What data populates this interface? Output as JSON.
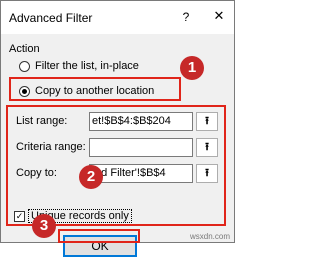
{
  "dialog": {
    "title": "Advanced Filter",
    "help_glyph": "?",
    "close_glyph": "✕"
  },
  "action": {
    "label": "Action",
    "options": [
      {
        "label": "Filter the list, in-place",
        "selected": false
      },
      {
        "label": "Copy to another location",
        "selected": true
      }
    ]
  },
  "fields": {
    "list_range": {
      "label": "List range:",
      "value": "et!$B$4:$B$204"
    },
    "criteria_range": {
      "label": "Criteria range:",
      "value": ""
    },
    "copy_to": {
      "label": "Copy to:",
      "value": ":ed Filter'!$B$4"
    },
    "collapse_glyph": "⭱"
  },
  "unique_records": {
    "label": "Unique records only",
    "checked": true,
    "check_glyph": "✓"
  },
  "buttons": {
    "ok": "OK"
  },
  "annotations": {
    "badges": [
      "1",
      "2",
      "3"
    ],
    "accent_color": "#e0251a",
    "badge_color": "#c62828"
  },
  "watermark": "wsxdn.com"
}
